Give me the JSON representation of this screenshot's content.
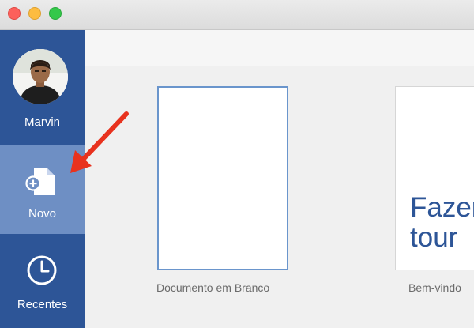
{
  "window": {
    "controls": [
      "close",
      "minimize",
      "maximize"
    ]
  },
  "sidebar": {
    "background": "#2d5597",
    "user": {
      "name": "Marvin",
      "avatar": "user-avatar-photo"
    },
    "items": [
      {
        "id": "new",
        "label": "Novo",
        "icon": "new-document-icon",
        "selected": true,
        "selected_color": "#6e8fc4"
      },
      {
        "id": "recent",
        "label": "Recentes",
        "icon": "clock-icon",
        "selected": false
      }
    ]
  },
  "templates": [
    {
      "id": "blank",
      "caption": "Documento em Branco",
      "selected": true
    },
    {
      "id": "tour",
      "thumbnail_text_line1": "Fazer",
      "thumbnail_text_line2": "tour",
      "caption": "Bem-vindo"
    }
  ],
  "annotation": {
    "type": "arrow",
    "color": "#e8321e",
    "points_to": "Novo"
  }
}
